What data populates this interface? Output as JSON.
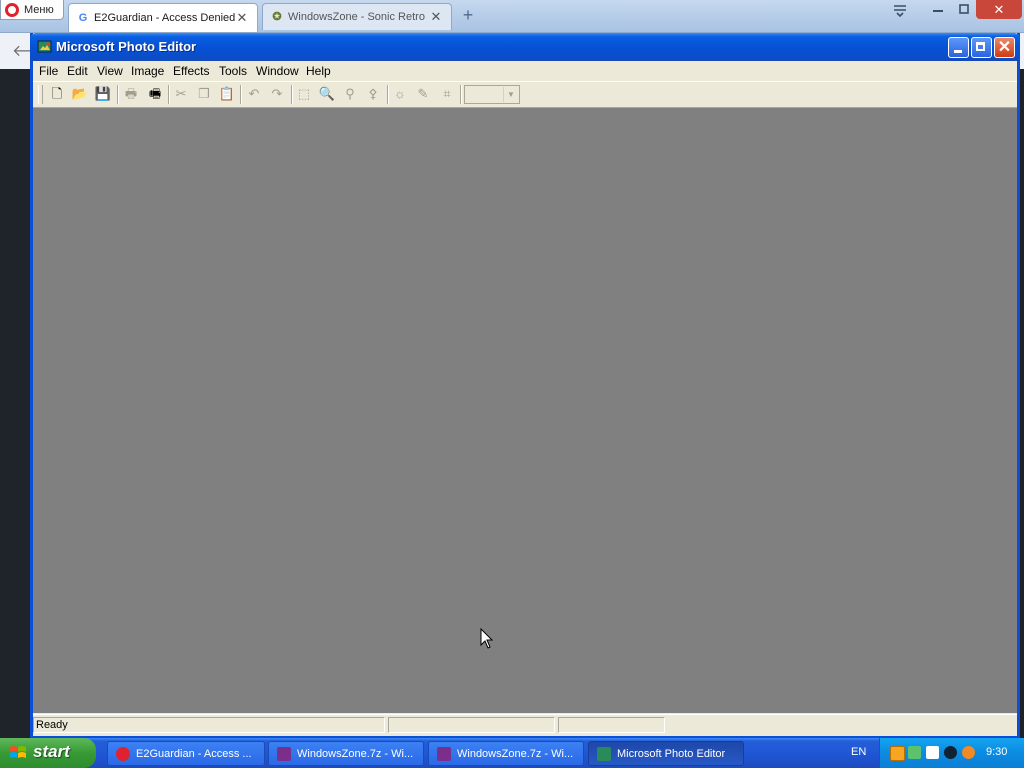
{
  "browser": {
    "menu_label": "Меню",
    "tabs": [
      {
        "title": "E2Guardian - Access Denied",
        "favicon": "G",
        "active": true
      },
      {
        "title": "WindowsZone - Sonic Retro",
        "favicon": "✪",
        "active": false
      }
    ],
    "new_tab_glyph": "+",
    "close_glyph": "✕",
    "back_glyph": "🡐"
  },
  "window": {
    "title": "Microsoft Photo Editor",
    "menu": [
      "File",
      "Edit",
      "View",
      "Image",
      "Effects",
      "Tools",
      "Window",
      "Help"
    ],
    "toolbar": [
      {
        "name": "new-icon",
        "glyph": "🗋",
        "enabled": true
      },
      {
        "name": "open-icon",
        "glyph": "📂",
        "enabled": true
      },
      {
        "name": "save-icon",
        "glyph": "💾",
        "enabled": false
      },
      {
        "name": "print-icon",
        "glyph": "🖶",
        "enabled": false
      },
      {
        "name": "scan-icon",
        "glyph": "🖷",
        "enabled": true
      },
      {
        "name": "cut-icon",
        "glyph": "✂",
        "enabled": false
      },
      {
        "name": "copy-icon",
        "glyph": "❐",
        "enabled": false
      },
      {
        "name": "paste-icon",
        "glyph": "📋",
        "enabled": false
      },
      {
        "name": "undo-icon",
        "glyph": "↶",
        "enabled": false
      },
      {
        "name": "redo-icon",
        "glyph": "↷",
        "enabled": false
      },
      {
        "name": "select-icon",
        "glyph": "⬚",
        "enabled": false
      },
      {
        "name": "zoom-icon",
        "glyph": "🔍",
        "enabled": false
      },
      {
        "name": "stamp-icon",
        "glyph": "⚲",
        "enabled": false
      },
      {
        "name": "smudge-icon",
        "glyph": "⚴",
        "enabled": false
      },
      {
        "name": "transparency-icon",
        "glyph": "☼",
        "enabled": false
      },
      {
        "name": "eyedropper-icon",
        "glyph": "✎",
        "enabled": false
      },
      {
        "name": "crop-icon",
        "glyph": "⌗",
        "enabled": false
      }
    ],
    "zoom_value": "",
    "status": {
      "text": "Ready",
      "pane2": "",
      "pane3": ""
    }
  },
  "taskbar": {
    "start_label": "start",
    "tasks": [
      {
        "label": "E2Guardian - Access ...",
        "icon_color": "#e0222e",
        "active": false
      },
      {
        "label": "WindowsZone.7z - Wi...",
        "icon_color": "#7a2f8c",
        "active": false
      },
      {
        "label": "WindowsZone.7z - Wi...",
        "icon_color": "#7a2f8c",
        "active": false
      },
      {
        "label": "Microsoft Photo Editor",
        "icon_color": "#2a8a5a",
        "active": true
      }
    ],
    "language": "EN",
    "clock": "9:30"
  },
  "colors": {
    "client_bg": "#808080",
    "titlebar_blue": "#0552d6",
    "chrome_gray": "#ece9d8"
  }
}
